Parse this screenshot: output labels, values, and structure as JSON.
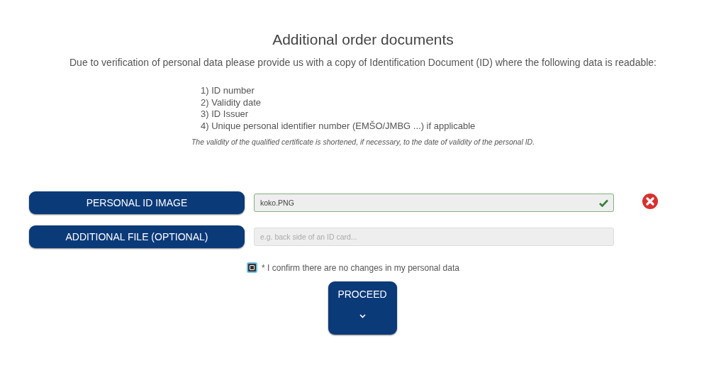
{
  "title": "Additional order documents",
  "intro": "Due to verification of personal data please provide us with a copy of Identification Document (ID) where the following data is readable:",
  "requirements": [
    "1) ID number",
    "2) Validity date",
    "3) ID Issuer",
    "4) Unique personal identifier number (EMŠO/JMBG ...) if applicable"
  ],
  "note": "The validity of the qualified certificate is shortened, if necessary, to the date of validity of the personal ID.",
  "uploads": [
    {
      "button": "PERSONAL ID IMAGE",
      "value": "koko.PNG",
      "valid": true,
      "removable": true
    },
    {
      "button": "ADDITIONAL FILE (OPTIONAL)",
      "placeholder": "e.g. back side of an ID card...",
      "valid": false,
      "removable": false
    }
  ],
  "confirm": {
    "label": "* I confirm there are no changes in my personal data",
    "checked": true
  },
  "proceed": {
    "label": "PROCEED"
  }
}
